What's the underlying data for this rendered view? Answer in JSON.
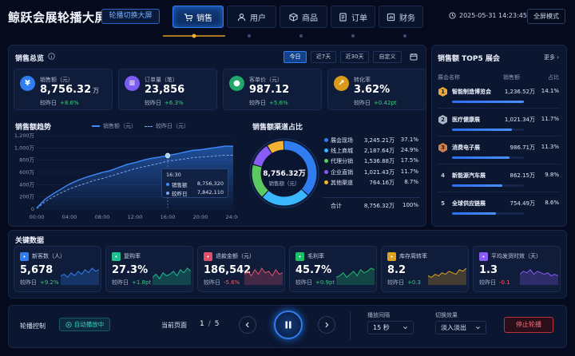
{
  "header": {
    "title": "鲸跃会展轮播大屏",
    "mode_button": "轮播切换大屏",
    "tabs": [
      {
        "label": "销售",
        "icon": "cart-icon",
        "active": true
      },
      {
        "label": "用户",
        "icon": "user-icon",
        "active": false
      },
      {
        "label": "商品",
        "icon": "box-icon",
        "active": false
      },
      {
        "label": "订单",
        "icon": "document-icon",
        "active": false
      },
      {
        "label": "财务",
        "icon": "finance-icon",
        "active": false
      }
    ],
    "datetime": "2025-05-31 14:23:45",
    "fullscreen": "全屏模式"
  },
  "overview": {
    "title": "销售总览",
    "ranges": [
      "今日",
      "近7天",
      "近30天",
      "自定义"
    ],
    "active_range": "今日",
    "kpis": [
      {
        "label": "销售额（元）",
        "value": "8,756.32",
        "unit": "万",
        "compare": "较昨日",
        "delta": "+8.6%",
        "icon": "yen-icon",
        "color": "#2f7df0"
      },
      {
        "label": "订单量（笔）",
        "value": "23,856",
        "unit": "",
        "compare": "较昨日",
        "delta": "+6.3%",
        "icon": "order-icon",
        "color": "#7b5cf5"
      },
      {
        "label": "客单价（元）",
        "value": "987.12",
        "unit": "",
        "compare": "较昨日",
        "delta": "+5.6%",
        "icon": "customer-icon",
        "color": "#1fa86a"
      },
      {
        "label": "转化率",
        "value": "3.62%",
        "unit": "",
        "compare": "较昨日",
        "delta": "+0.42pt",
        "icon": "trend-icon",
        "color": "#d99a1c"
      }
    ]
  },
  "trend": {
    "title": "销售额趋势",
    "legend_today": "销售额（元）",
    "legend_yesterday": "较昨日（元）",
    "tooltip": {
      "time": "16:30",
      "today_label": "销售额",
      "today_value": "8,756,320",
      "yest_label": "较昨日",
      "yest_value": "7,842,110"
    }
  },
  "channel": {
    "title": "销售额渠道占比",
    "center_value": "8,756.32万",
    "center_label": "销售额（元）",
    "rows": [
      {
        "name": "展会现场",
        "amount": "3,245.21万",
        "pct": "37.1%",
        "color": "#2f7df0"
      },
      {
        "name": "线上商城",
        "amount": "2,187.64万",
        "pct": "24.9%",
        "color": "#39b7ff"
      },
      {
        "name": "代理分销",
        "amount": "1,536.88万",
        "pct": "17.5%",
        "color": "#5cc860"
      },
      {
        "name": "企业直销",
        "amount": "1,021.43万",
        "pct": "11.7%",
        "color": "#8a5cf6"
      },
      {
        "name": "其他渠道",
        "amount": "764.16万",
        "pct": "8.7%",
        "color": "#f2b233"
      }
    ],
    "total_label": "合计",
    "total_amount": "8,756.32万",
    "total_pct": "100%"
  },
  "top5": {
    "title": "销售额 TOP5 展会",
    "more": "更多",
    "col_name": "展会名称",
    "col_amount": "销售额",
    "col_pct": "占比",
    "items": [
      {
        "rank": "1",
        "name": "智能制造博览会",
        "amount": "1,236.52万",
        "pct": "14.1%",
        "fill": 1.0
      },
      {
        "rank": "2",
        "name": "医疗健康展",
        "amount": "1,021.34万",
        "pct": "11.7%",
        "fill": 0.83
      },
      {
        "rank": "3",
        "name": "消费电子展",
        "amount": "986.71万",
        "pct": "11.3%",
        "fill": 0.8
      },
      {
        "rank": "4",
        "name": "新能源汽车展",
        "amount": "862.15万",
        "pct": "9.8%",
        "fill": 0.7
      },
      {
        "rank": "5",
        "name": "全球供应链展",
        "amount": "754.49万",
        "pct": "8.6%",
        "fill": 0.61
      }
    ]
  },
  "key_data": {
    "title": "关键数据",
    "metrics": [
      {
        "label": "新客数（人）",
        "value": "5,678",
        "compare": "较昨日",
        "delta": "+9.2%",
        "trend": "up",
        "color": "#2f7df0",
        "icon": "new-customer-icon"
      },
      {
        "label": "复购率",
        "value": "27.3%",
        "compare": "较昨日",
        "delta": "+1.8pt",
        "trend": "up",
        "color": "#1fbf8f",
        "icon": "repurchase-icon"
      },
      {
        "label": "退款金额（元）",
        "value": "186,542",
        "compare": "较昨日",
        "delta": "-5.6%",
        "trend": "down",
        "color": "#e0506a",
        "icon": "refund-icon"
      },
      {
        "label": "毛利率",
        "value": "45.7%",
        "compare": "较昨日",
        "delta": "+0.9pt",
        "trend": "up",
        "color": "#1fbf6a",
        "icon": "margin-icon"
      },
      {
        "label": "库存周转率",
        "value": "8.2",
        "compare": "较昨日",
        "delta": "+0.3",
        "trend": "up",
        "color": "#e0a020",
        "icon": "inventory-icon"
      },
      {
        "label": "平均发货时效（天）",
        "value": "1.3",
        "compare": "较昨日",
        "delta": "-0.1",
        "trend": "down",
        "color": "#8a5cf6",
        "icon": "shipping-icon"
      }
    ]
  },
  "control": {
    "title": "轮播控制",
    "auto": "自动播放中",
    "page_label": "当前页面",
    "page_current": "1",
    "page_sep": "/",
    "page_total": "5",
    "interval_label": "播放间隔",
    "interval_value": "15 秒",
    "effect_label": "切换效果",
    "effect_value": "淡入淡出",
    "stop": "停止轮播"
  },
  "chart_data": {
    "type": "line",
    "x": [
      "00:00",
      "01:00",
      "02:00",
      "03:00",
      "04:00",
      "05:00",
      "06:00",
      "07:00",
      "08:00",
      "09:00",
      "10:00",
      "11:00",
      "12:00",
      "13:00",
      "14:00",
      "15:00",
      "16:00",
      "17:00",
      "18:00",
      "19:00",
      "20:00",
      "21:00",
      "22:00",
      "23:00",
      "24:00"
    ],
    "xticks": [
      "00:00",
      "04:00",
      "08:00",
      "12:00",
      "16:00",
      "20:00",
      "24:00"
    ],
    "yticks": [
      "0",
      "200万",
      "400万",
      "600万",
      "800万",
      "1,000万",
      "1,200万"
    ],
    "ylim": [
      0,
      12000000
    ],
    "series": [
      {
        "name": "销售额（元）",
        "values": [
          200000,
          1600000,
          2500000,
          3300000,
          4100000,
          4700000,
          5200000,
          5600000,
          6000000,
          6300000,
          6800000,
          7300000,
          7600000,
          8000000,
          8300000,
          8500000,
          8756320,
          9000000,
          9300000,
          9600000,
          9700000,
          9900000,
          10100000,
          10300000,
          10300000
        ]
      },
      {
        "name": "较昨日（元）",
        "values": [
          100000,
          1200000,
          2000000,
          2700000,
          3300000,
          3800000,
          4200000,
          4700000,
          5000000,
          5400000,
          5800000,
          6200000,
          6600000,
          6900000,
          7200000,
          7500000,
          7842110,
          8000000,
          8200000,
          8400000,
          8500000,
          8600000,
          8700000,
          8800000,
          8800000
        ]
      }
    ]
  }
}
